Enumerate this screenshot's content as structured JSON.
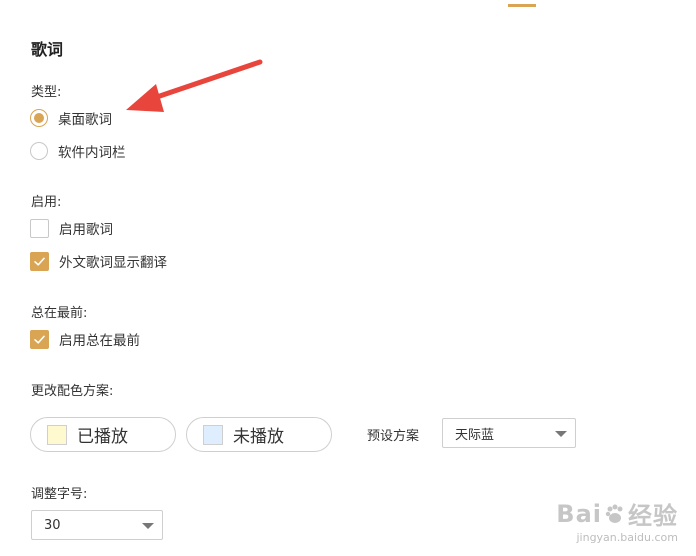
{
  "panel": {
    "title": "歌词",
    "type_label": "类型:",
    "type_options": [
      {
        "label": "桌面歌词",
        "selected": true
      },
      {
        "label": "软件内词栏",
        "selected": false
      }
    ],
    "enable_label": "启用:",
    "enable_options": [
      {
        "label": "启用歌词",
        "checked": false
      },
      {
        "label": "外文歌词显示翻译",
        "checked": true
      }
    ],
    "ontop_label": "总在最前:",
    "ontop_options": [
      {
        "label": "启用总在最前",
        "checked": true
      }
    ],
    "color_label": "更改配色方案:",
    "played": {
      "label": "已播放",
      "color": "#fff9d0"
    },
    "unplayed": {
      "label": "未播放",
      "color": "#deeeff"
    },
    "preset_label": "预设方案",
    "preset_value": "天际蓝",
    "fontsize_label": "调整字号:",
    "fontsize_value": "30"
  },
  "colors": {
    "accent": "#d9a453",
    "arrow": "#e8453c"
  },
  "watermark": {
    "logo_left": "Bai",
    "logo_right": "经验",
    "url": "jingyan.baidu.com"
  }
}
